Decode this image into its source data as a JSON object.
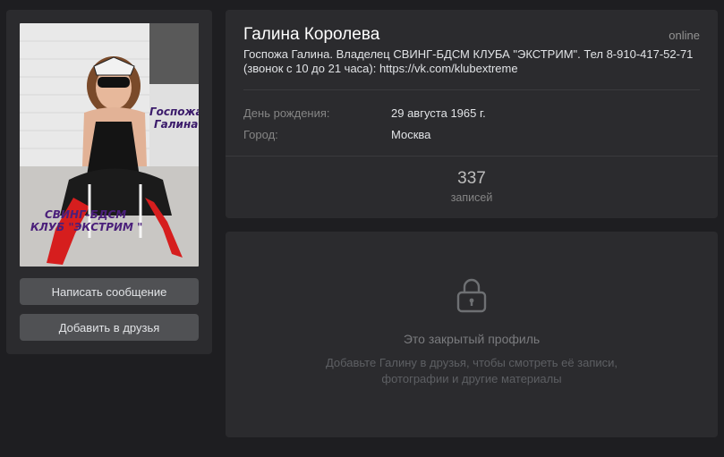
{
  "profile": {
    "name": "Галина Королева",
    "online": "online",
    "status": "Госпожа Галина. Владелец СВИНГ-БДСМ КЛУБА \"ЭКСТРИМ\". Тел 8-910-417-52-71 (звонок с 10 до 21 часа): https://vk.com/klubextreme",
    "info": [
      {
        "label": "День рождения:",
        "value": "29 августа 1965 г."
      },
      {
        "label": "Город:",
        "value": "Москва"
      }
    ],
    "counter": {
      "value": "337",
      "label": "записей"
    }
  },
  "avatar": {
    "caption_top": "Госпожа\nГалина",
    "caption_bottom": "СВИНГ-БДСМ\nКЛУБ \"ЭКСТРИМ \""
  },
  "buttons": {
    "message": "Написать сообщение",
    "add_friend": "Добавить в друзья"
  },
  "closed": {
    "icon": "lock-icon",
    "title": "Это закрытый профиль",
    "description": "Добавьте Галину в друзья, чтобы смотреть её записи, фотографии и другие материалы"
  }
}
